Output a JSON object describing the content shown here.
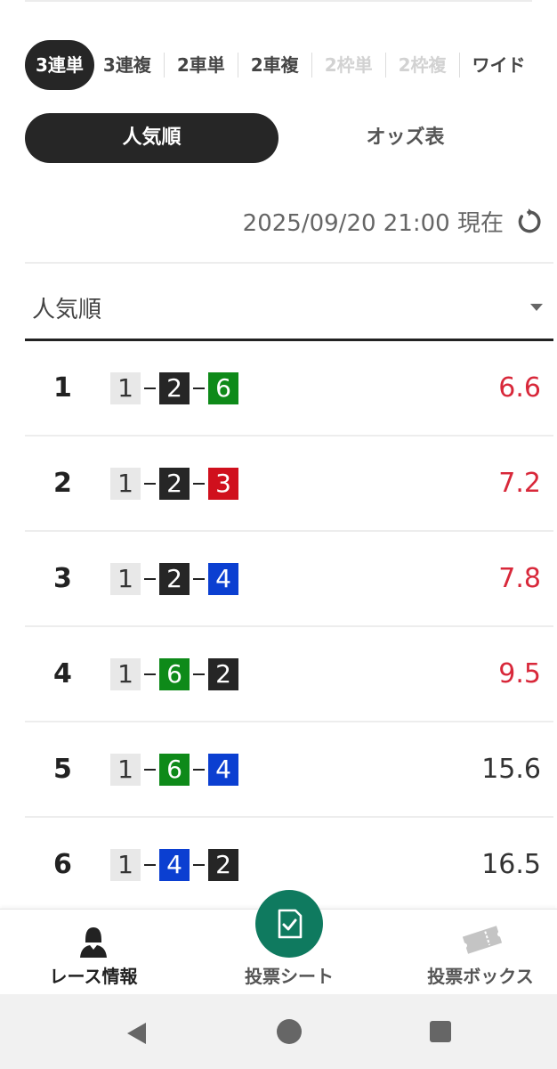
{
  "bet_tabs": [
    {
      "label": "3連単",
      "state": "active"
    },
    {
      "label": "3連複",
      "state": "normal"
    },
    {
      "label": "2車単",
      "state": "normal"
    },
    {
      "label": "2車複",
      "state": "normal"
    },
    {
      "label": "2枠単",
      "state": "disabled"
    },
    {
      "label": "2枠複",
      "state": "disabled"
    },
    {
      "label": "ワイド",
      "state": "normal"
    }
  ],
  "sort_tabs": {
    "popularity": "人気順",
    "odds_table": "オッズ表"
  },
  "timestamp": "2025/09/20 21:00 現在",
  "dropdown": {
    "selected": "人気順"
  },
  "rows": [
    {
      "rank": "1",
      "combo": [
        "1",
        "2",
        "6"
      ],
      "odds": "6.6",
      "hot": true
    },
    {
      "rank": "2",
      "combo": [
        "1",
        "2",
        "3"
      ],
      "odds": "7.2",
      "hot": true
    },
    {
      "rank": "3",
      "combo": [
        "1",
        "2",
        "4"
      ],
      "odds": "7.8",
      "hot": true
    },
    {
      "rank": "4",
      "combo": [
        "1",
        "6",
        "2"
      ],
      "odds": "9.5",
      "hot": true
    },
    {
      "rank": "5",
      "combo": [
        "1",
        "6",
        "4"
      ],
      "odds": "15.6",
      "hot": false
    },
    {
      "rank": "6",
      "combo": [
        "1",
        "4",
        "2"
      ],
      "odds": "16.5",
      "hot": false
    }
  ],
  "bottom_nav": {
    "race_info": "レース情報",
    "vote_sheet": "投票シート",
    "vote_box": "投票ボックス"
  },
  "colors": {
    "accent_dark": "#262626",
    "fab_green": "#0f7a5f",
    "hot_odds": "#d8283a",
    "car_1": "#e8e8e8",
    "car_2": "#262626",
    "car_3": "#d0101d",
    "car_4": "#0b3fd1",
    "car_6": "#0e8a19"
  }
}
